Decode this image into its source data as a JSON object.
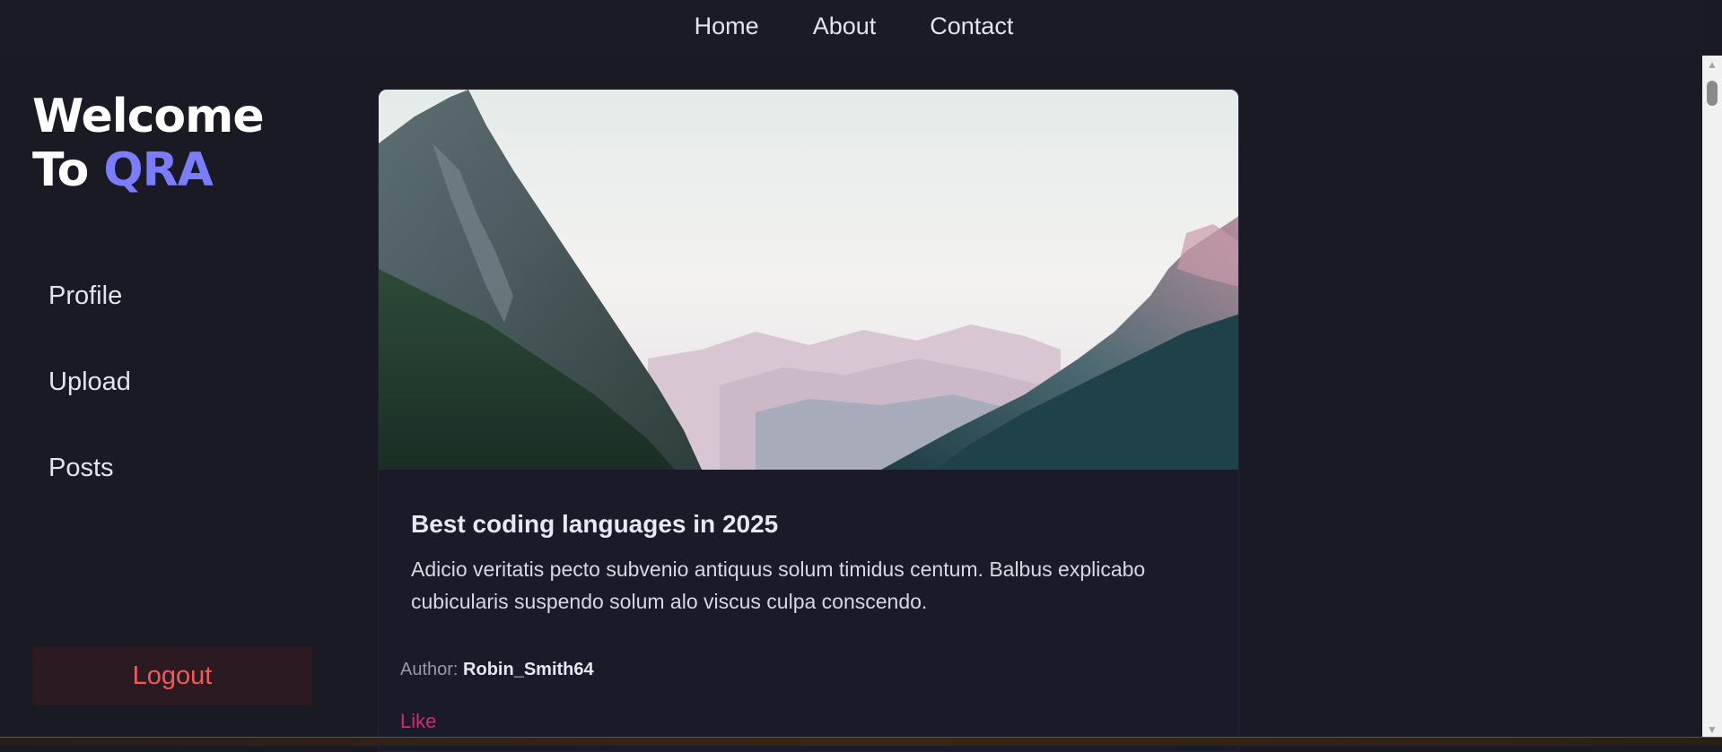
{
  "topnav": {
    "items": [
      {
        "label": "Home"
      },
      {
        "label": "About"
      },
      {
        "label": "Contact"
      }
    ]
  },
  "sidebar": {
    "welcome_line1": "Welcome",
    "welcome_line2": "To",
    "brand": "QRA",
    "items": [
      {
        "label": "Profile"
      },
      {
        "label": "Upload"
      },
      {
        "label": "Posts"
      }
    ],
    "logout_label": "Logout"
  },
  "post": {
    "title": "Best coding languages in 2025",
    "text": "Adicio veritatis pecto subvenio antiquus solum timidus centum. Balbus explicabo cubicularis suspendo solum alo viscus culpa conscendo.",
    "author_label": "Author:",
    "author_name": "Robin_Smith64",
    "like_label": "Like"
  },
  "colors": {
    "background": "#1a1a25",
    "brand_accent": "#7a7dff",
    "logout_text": "#f25a5a",
    "like_text": "#d6287a"
  }
}
